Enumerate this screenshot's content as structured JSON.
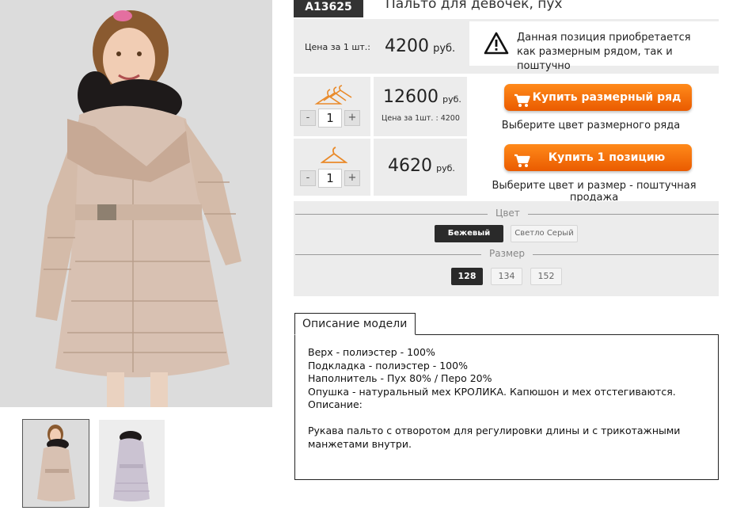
{
  "product": {
    "sku": "A13625",
    "title": "Пальто для девочек, пух"
  },
  "price_row": {
    "label": "Цена за 1 шт.:",
    "price": "4200",
    "currency": "руб.",
    "notice": "Данная позиция приобретается как размерным рядом, так и поштучно"
  },
  "set_row": {
    "quantity": "1",
    "price": "12600",
    "currency": "руб.",
    "unit_note": "Цена за 1шт. : 4200",
    "button": "Купить размерный ряд",
    "hint": "Выберите цвет размерного ряда"
  },
  "single_row": {
    "quantity": "1",
    "price": "4620",
    "currency": "руб.",
    "button": "Купить 1 позицию",
    "hint": "Выберите цвет и размер - поштучная продажа"
  },
  "qty_controls": {
    "minus": "-",
    "plus": "+"
  },
  "color": {
    "title": "Цвет",
    "options": [
      "Бежевый",
      "Светло Серый"
    ],
    "selected": "Бежевый"
  },
  "size": {
    "title": "Размер",
    "options": [
      "128",
      "134",
      "152"
    ],
    "selected": "128"
  },
  "description": {
    "tab": "Описание модели",
    "lines": [
      "Верх - полиэстер - 100%",
      "Подкладка - полиэстер - 100%",
      "Наполнитель - Пух 80% / Перо 20%",
      "Опушка - натуральный мех КРОЛИКА. Капюшон и мех отстегиваются.",
      "Описание:",
      "",
      "Рукава пальто с отворотом для регулировки длины и с трикотажными манжетами внутри."
    ]
  },
  "colors": {
    "accent": "#f07010",
    "panel": "#ececec",
    "badge": "#333333"
  },
  "icons": [
    "warning-icon",
    "hanger-set-icon",
    "hanger-icon",
    "cart-icon"
  ]
}
